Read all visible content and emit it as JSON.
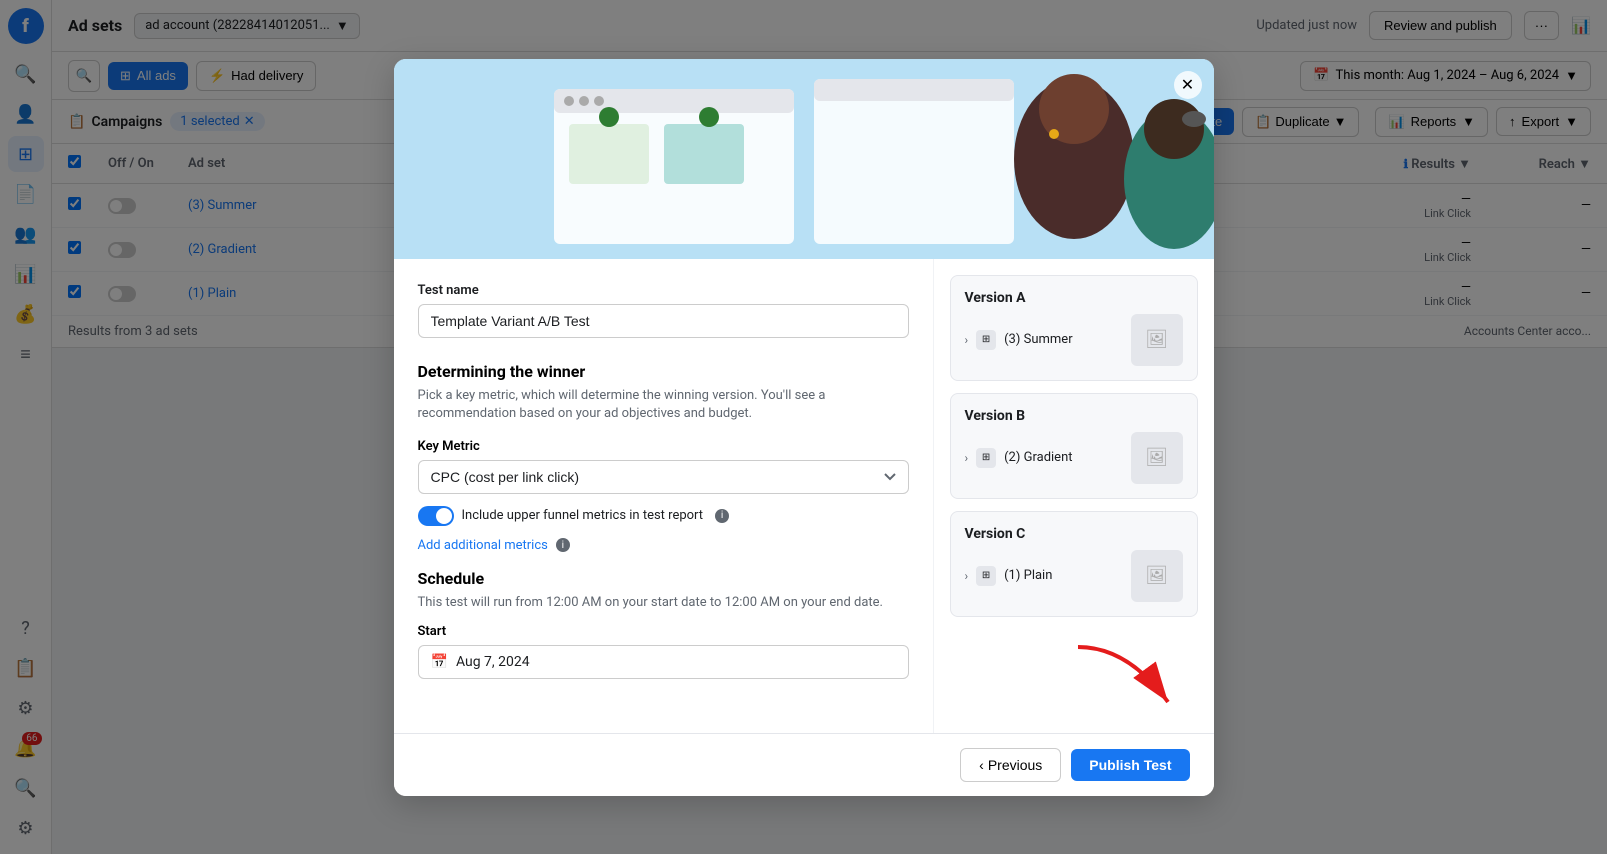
{
  "app": {
    "logo": "f",
    "title": "Ad sets",
    "account": "ad account (28228414012051...",
    "updated": "Updated just now",
    "review_publish": "Review and publish"
  },
  "toolbar": {
    "all_ads": "All ads",
    "had_delivery": "Had delivery",
    "date_range": "This month: Aug 1, 2024 – Aug 6, 2024",
    "reports": "Reports",
    "export": "Export"
  },
  "campaign_bar": {
    "campaigns_label": "Campaigns",
    "selected_count": "1 selected",
    "create": "+ Create",
    "duplicate": "Duplicate"
  },
  "table": {
    "columns": [
      "Off / On",
      "Ad set",
      "Results",
      "Reach"
    ],
    "rows": [
      {
        "name": "(3) Summer",
        "results": "—",
        "results_label": "Link Click",
        "reach": "—"
      },
      {
        "name": "(2) Gradient",
        "results": "—",
        "results_label": "Link Click",
        "reach": "—"
      },
      {
        "name": "(1) Plain",
        "results": "—",
        "results_label": "Link Click",
        "reach": "—"
      }
    ],
    "summary": "Results from 3 ad sets",
    "accounts_center": "Accounts Center acco..."
  },
  "modal": {
    "close_label": "×",
    "test_name_label": "Test name",
    "test_name_value": "Template Variant A/B Test",
    "determining_title": "Determining the winner",
    "determining_desc": "Pick a key metric, which will determine the winning version. You'll see a recommendation based on your ad objectives and budget.",
    "key_metric_label": "Key Metric",
    "key_metric_value": "CPC (cost per link click)",
    "toggle_label": "Include upper funnel metrics in test report",
    "add_metrics": "Add additional metrics",
    "schedule_title": "Schedule",
    "schedule_desc": "This test will run from 12:00 AM on your start date to 12:00 AM on your end date.",
    "start_label": "Start",
    "start_date": "Aug 7, 2024",
    "versions": [
      {
        "id": "A",
        "title": "Version A",
        "item": "(3) Summer"
      },
      {
        "id": "B",
        "title": "Version B",
        "item": "(2) Gradient"
      },
      {
        "id": "C",
        "title": "Version C",
        "item": "(1) Plain"
      }
    ],
    "previous_btn": "Previous",
    "publish_btn": "Publish Test"
  },
  "sidebar": {
    "items": [
      {
        "icon": "🔍",
        "name": "search",
        "label": "Search"
      },
      {
        "icon": "👤",
        "name": "profile",
        "label": "Profile"
      },
      {
        "icon": "⊞",
        "name": "dashboard",
        "label": "Dashboard",
        "active": true
      },
      {
        "icon": "📄",
        "name": "ads",
        "label": "Ads"
      },
      {
        "icon": "👥",
        "name": "audience",
        "label": "Audience"
      },
      {
        "icon": "📊",
        "name": "analytics",
        "label": "Analytics"
      },
      {
        "icon": "💰",
        "name": "billing",
        "label": "Billing"
      },
      {
        "icon": "≡",
        "name": "menu",
        "label": "Menu"
      },
      {
        "icon": "?",
        "name": "help",
        "label": "Help"
      },
      {
        "icon": "📋",
        "name": "reports-side",
        "label": "Reports"
      },
      {
        "icon": "⚙",
        "name": "settings",
        "label": "Settings"
      },
      {
        "icon": "🔔",
        "name": "notifications",
        "label": "Notifications",
        "badge": "66"
      },
      {
        "icon": "🔍",
        "name": "search2",
        "label": "Search 2"
      },
      {
        "icon": "⚙",
        "name": "settings2",
        "label": "Settings 2"
      }
    ]
  }
}
